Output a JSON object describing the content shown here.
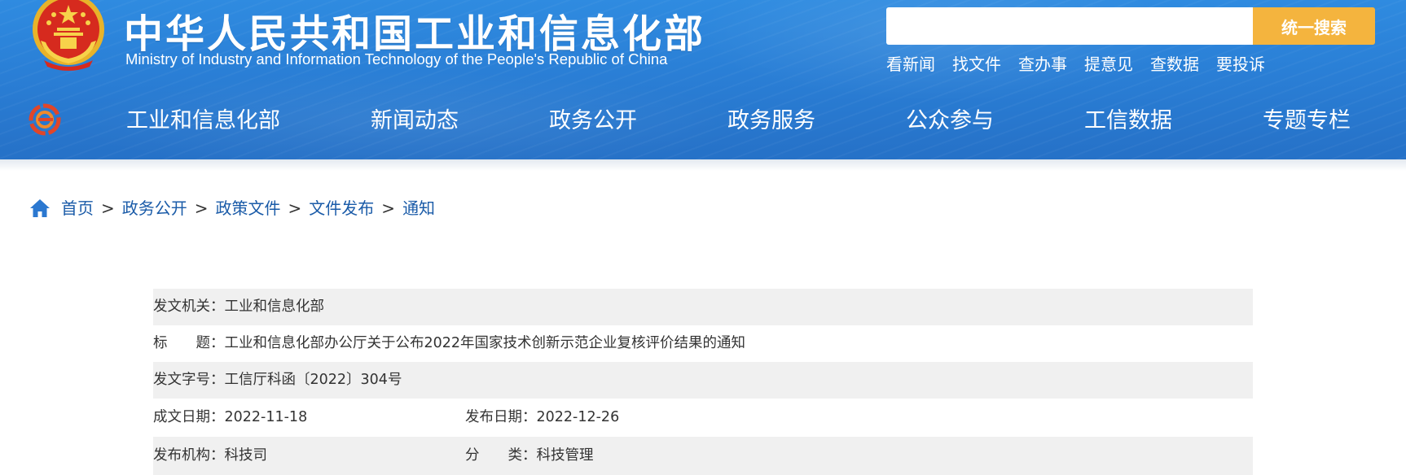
{
  "header": {
    "title": "中华人民共和国工业和信息化部",
    "subtitle": "Ministry of Industry and Information Technology of the People's Republic of China",
    "emblem_icon": "national-emblem-icon",
    "colors": {
      "header_blue": "#2a7fd6",
      "search_button": "#f4b43e"
    }
  },
  "search": {
    "placeholder": "",
    "button_label": "统一搜索"
  },
  "quick_links": [
    "看新闻",
    "找文件",
    "查办事",
    "提意见",
    "查数据",
    "要投诉"
  ],
  "nav": {
    "logo_icon": "miit-logo-icon",
    "items": [
      "工业和信息化部",
      "新闻动态",
      "政务公开",
      "政务服务",
      "公众参与",
      "工信数据",
      "专题专栏"
    ]
  },
  "breadcrumb": {
    "home_icon": "home-icon",
    "items": [
      "首页",
      "政务公开",
      "政策文件",
      "文件发布",
      "通知"
    ],
    "separator": ">"
  },
  "info": {
    "issuer_label": "发文机关：",
    "issuer": "工业和信息化部",
    "title_label": "标　　题：",
    "title": "工业和信息化部办公厅关于公布2022年国家技术创新示范企业复核评价结果的通知",
    "doc_no_label": "发文字号：",
    "doc_no": "工信厅科函〔2022〕304号",
    "date_written_label": "成文日期：",
    "date_written": "2022-11-18",
    "date_published_label": "发布日期：",
    "date_published": "2022-12-26",
    "publisher_label": "发布机构：",
    "publisher": "科技司",
    "category_label": "分　　类：",
    "category": "科技管理"
  }
}
